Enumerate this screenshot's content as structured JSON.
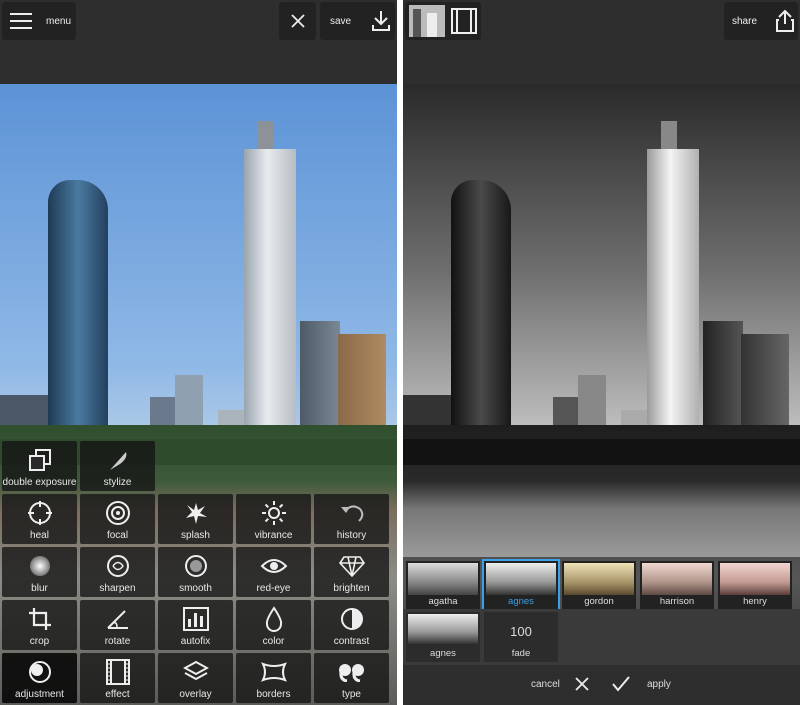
{
  "left": {
    "menu_label": "menu",
    "save_label": "save",
    "tools": [
      {
        "label": "double exposure",
        "icon": "double-exposure-icon"
      },
      {
        "label": "stylize",
        "icon": "feather-icon"
      },
      {
        "label": "heal",
        "icon": "target-icon"
      },
      {
        "label": "focal",
        "icon": "focal-icon"
      },
      {
        "label": "splash",
        "icon": "splash-icon"
      },
      {
        "label": "vibrance",
        "icon": "sun-icon"
      },
      {
        "label": "history",
        "icon": "undo-icon"
      },
      {
        "label": "blur",
        "icon": "blur-icon"
      },
      {
        "label": "sharpen",
        "icon": "sharpen-icon"
      },
      {
        "label": "smooth",
        "icon": "smooth-icon"
      },
      {
        "label": "red-eye",
        "icon": "eye-icon"
      },
      {
        "label": "brighten",
        "icon": "diamond-icon"
      },
      {
        "label": "crop",
        "icon": "crop-icon"
      },
      {
        "label": "rotate",
        "icon": "rotate-icon"
      },
      {
        "label": "autofix",
        "icon": "bar-chart-icon"
      },
      {
        "label": "color",
        "icon": "drop-icon"
      },
      {
        "label": "contrast",
        "icon": "contrast-icon"
      },
      {
        "label": "adjustment",
        "icon": "adjustment-icon"
      },
      {
        "label": "effect",
        "icon": "film-icon"
      },
      {
        "label": "overlay",
        "icon": "layers-icon"
      },
      {
        "label": "borders",
        "icon": "borders-icon"
      },
      {
        "label": "type",
        "icon": "quote-icon"
      }
    ]
  },
  "right": {
    "share_label": "share",
    "filters": [
      {
        "label": "agatha"
      },
      {
        "label": "agnes",
        "active": true
      },
      {
        "label": "gordon"
      },
      {
        "label": "harrison"
      },
      {
        "label": "henry"
      }
    ],
    "sub_filter_label": "agnes",
    "fade_value": "100",
    "fade_label": "fade",
    "cancel_label": "cancel",
    "apply_label": "apply"
  },
  "colors": {
    "accent": "#3aa0e8",
    "toolbar": "#2e2e2e",
    "button": "#222222"
  }
}
